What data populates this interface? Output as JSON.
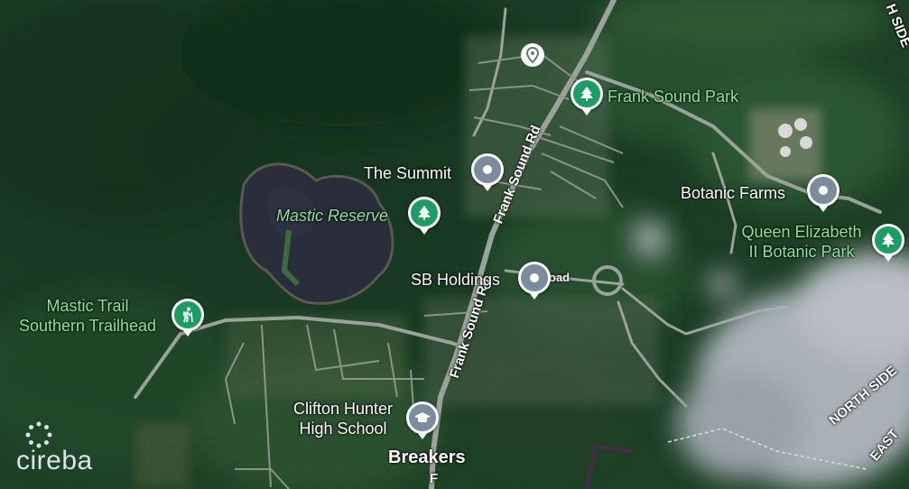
{
  "map": {
    "labels": {
      "the_summit": "The Summit",
      "frank_sound_park": "Frank Sound Park",
      "botanic_farms": "Botanic Farms",
      "mastic_reserve": "Mastic Reserve",
      "queen_elizabeth_line1": "Queen Elizabeth",
      "queen_elizabeth_line2": "II Botanic Park",
      "sb_holdings": "SB Holdings",
      "sb_overlap": "oad",
      "mastic_trail_line1": "Mastic Trail",
      "mastic_trail_line2": "Southern Trailhead",
      "clifton_line1": "Clifton Hunter",
      "clifton_line2": "High School",
      "breakers": "Breakers"
    },
    "roads": {
      "frank_sound_rd_north": "Frank Sound Rd",
      "frank_sound_rd_south": "Frank Sound Rd",
      "north_side_top": "H SIDE",
      "north_side_bottom": "NORTH SIDE",
      "east": "EAST",
      "frank_edge": "F"
    },
    "icons": {
      "the_summit": "location-pin-icon",
      "botanic_farms": "location-pin-icon",
      "sb_holdings": "location-pin-icon",
      "top_place": "location-outline-icon",
      "frank_sound_park": "park-tree-icon",
      "mastic_reserve": "park-tree-icon",
      "queen_elizabeth": "park-tree-icon",
      "mastic_trail": "hiking-icon",
      "clifton_hunter": "school-icon"
    },
    "colors": {
      "pin_grey": "#7b8d9c",
      "pin_green": "#1a9f63",
      "park_label": "#8ee39a"
    }
  },
  "branding": {
    "logo_text": "cireba"
  }
}
